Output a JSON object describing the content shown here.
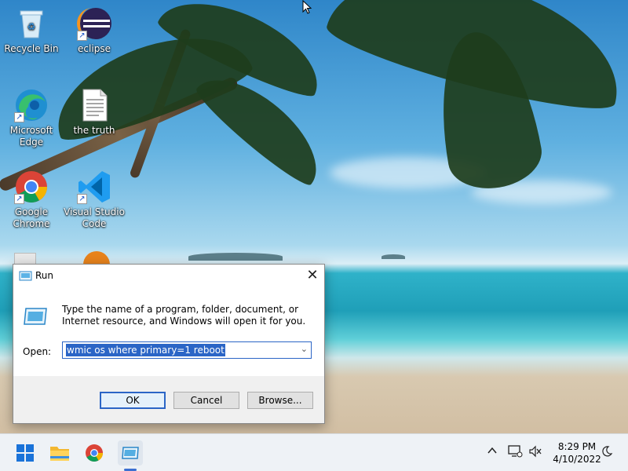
{
  "desktop": {
    "icons": [
      {
        "label": "Recycle Bin"
      },
      {
        "label": "eclipse"
      },
      {
        "label": "Microsoft Edge"
      },
      {
        "label": "the truth"
      },
      {
        "label": "Google Chrome"
      },
      {
        "label": "Visual Studio Code"
      }
    ]
  },
  "run_dialog": {
    "title": "Run",
    "close_glyph": "✕",
    "description": "Type the name of a program, folder, document, or Internet resource, and Windows will open it for you.",
    "open_label": "Open:",
    "open_value": "wmic os where primary=1 reboot",
    "ok_label": "OK",
    "cancel_label": "Cancel",
    "browse_label": "Browse..."
  },
  "taskbar": {
    "clock_time": "8:29 PM",
    "clock_date": "4/10/2022",
    "accent": "#3b6fd1"
  }
}
